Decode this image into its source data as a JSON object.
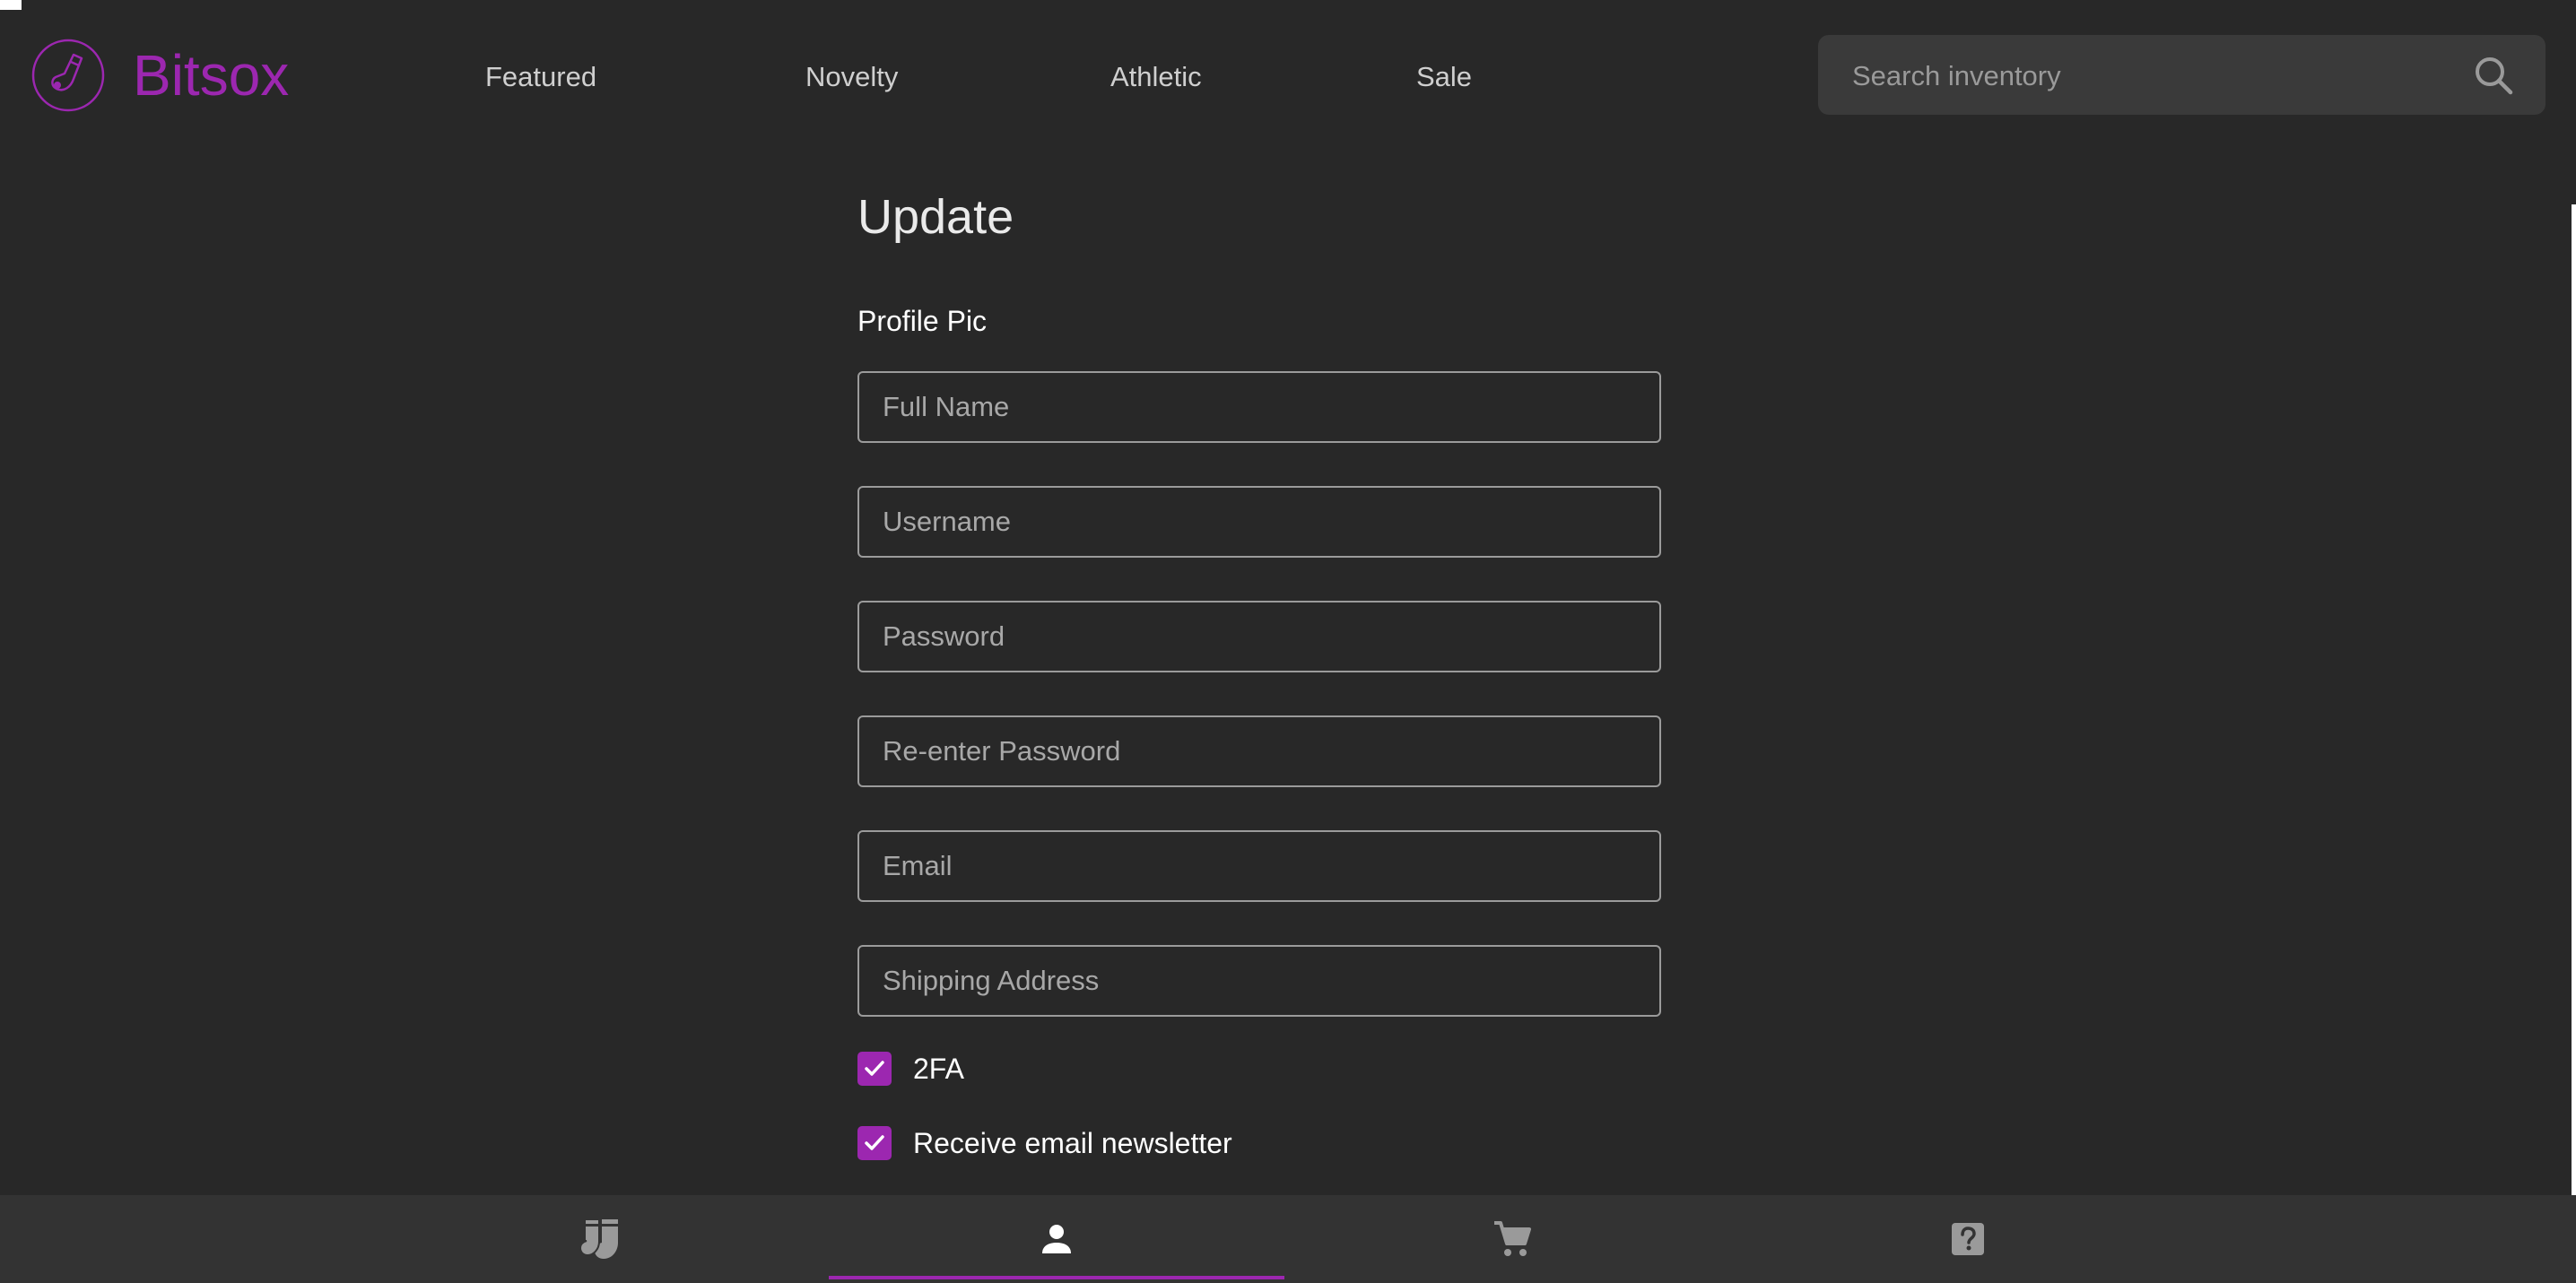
{
  "app": {
    "brand": "Bitsox",
    "accent_color": "#9c27b0",
    "background_color": "#282828"
  },
  "header": {
    "nav": [
      {
        "label": "Featured"
      },
      {
        "label": "Novelty"
      },
      {
        "label": "Athletic"
      },
      {
        "label": "Sale"
      }
    ],
    "search": {
      "placeholder": "Search inventory",
      "value": "",
      "icon": "search-icon"
    }
  },
  "form": {
    "title": "Update",
    "profile_pic_label": "Profile Pic",
    "fields": [
      {
        "placeholder": "Full Name",
        "value": ""
      },
      {
        "placeholder": "Username",
        "value": ""
      },
      {
        "placeholder": "Password",
        "value": ""
      },
      {
        "placeholder": "Re-enter Password",
        "value": ""
      },
      {
        "placeholder": "Email",
        "value": ""
      },
      {
        "placeholder": "Shipping Address",
        "value": ""
      }
    ],
    "checkboxes": [
      {
        "label": "2FA",
        "checked": true
      },
      {
        "label": "Receive email newsletter",
        "checked": true
      }
    ]
  },
  "bottom_nav": {
    "tabs": [
      {
        "icon": "socks-icon",
        "active": false
      },
      {
        "icon": "person-icon",
        "active": true
      },
      {
        "icon": "cart-icon",
        "active": false
      },
      {
        "icon": "help-icon",
        "active": false
      }
    ]
  }
}
